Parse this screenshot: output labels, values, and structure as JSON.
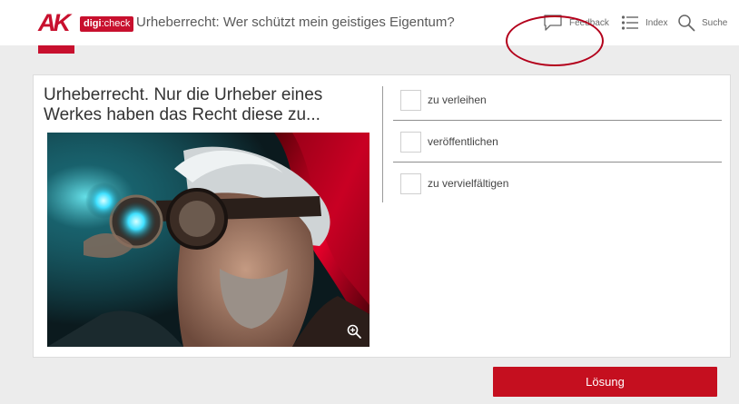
{
  "header": {
    "logo_ak": "AK",
    "logo_digi": "digi",
    "logo_check": "check",
    "title": "Urheberrecht: Wer schützt mein geistiges Eigentum?",
    "nav": {
      "feedback": "Feedback",
      "index": "Index",
      "search": "Suche"
    }
  },
  "question": {
    "text": "Urheberrecht. Nur die Urheber eines Werkes haben das Recht diese zu..."
  },
  "options": [
    {
      "label": "zu verleihen"
    },
    {
      "label": "veröffentlichen"
    },
    {
      "label": "zu vervielfältigen"
    }
  ],
  "solution_button": "Lösung",
  "colors": {
    "brand_red": "#c8102e",
    "button_red": "#c50f1f",
    "background": "#ececec",
    "annotation": "#b3001b"
  },
  "icons": {
    "feedback": "speech-bubble-icon",
    "index": "list-icon",
    "search": "magnifier-icon",
    "zoom": "zoom-in-icon"
  }
}
